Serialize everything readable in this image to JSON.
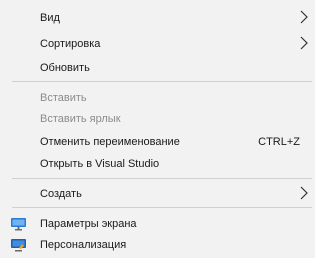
{
  "menu": {
    "items": {
      "view": {
        "label": "Вид"
      },
      "sort": {
        "label": "Сортировка"
      },
      "refresh": {
        "label": "Обновить"
      },
      "paste": {
        "label": "Вставить"
      },
      "paste_shortcut": {
        "label": "Вставить ярлык"
      },
      "undo_rename": {
        "label": "Отменить переименование",
        "shortcut": "CTRL+Z"
      },
      "open_vs": {
        "label": "Открыть в Visual Studio"
      },
      "create": {
        "label": "Создать"
      },
      "display_settings": {
        "label": "Параметры экрана",
        "icon": "display-icon"
      },
      "personalize": {
        "label": "Персонализация",
        "icon": "personalization-icon"
      }
    }
  },
  "colors": {
    "background": "#f2f2f2",
    "text": "#1a1a1a",
    "disabled_text": "#8c8c8c",
    "separator": "#d0d0d0",
    "icon_blue": "#2b7bd3"
  }
}
